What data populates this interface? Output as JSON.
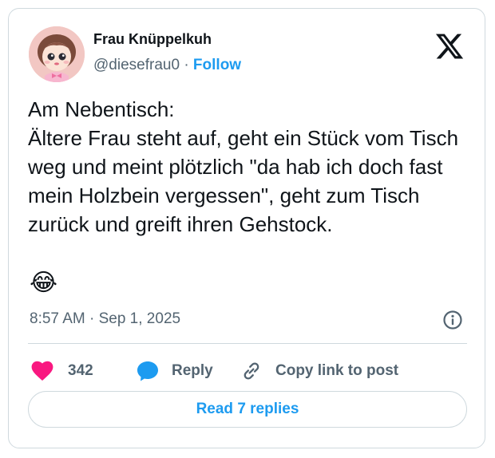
{
  "author": {
    "name": "Frau Knüppelkuh",
    "handle": "@diesefrau0",
    "separator": "·",
    "follow_label": "Follow",
    "avatar_icon": "cartoon-girl-avatar"
  },
  "brand": {
    "logo_icon": "x-logo"
  },
  "post": {
    "text": "Am Nebentisch:\nÄltere Frau steht auf, geht ein Stück vom Tisch weg und meint plötzlich \"da hab ich doch fast mein Holzbein vergessen\", geht zum Tisch zurück und greift ihren Gehstock.",
    "emoji": "😂",
    "timestamp": "8:57 AM · Sep 1, 2025"
  },
  "actions": {
    "like_count": "342",
    "reply_label": "Reply",
    "copy_link_label": "Copy link to post",
    "like_color": "#f91880",
    "reply_color": "#1d9bf0"
  },
  "footer": {
    "read_replies_label": "Read 7 replies"
  },
  "colors": {
    "accent": "#1d9bf0",
    "text": "#0f1419",
    "muted": "#536471",
    "border": "#cfd9de"
  }
}
